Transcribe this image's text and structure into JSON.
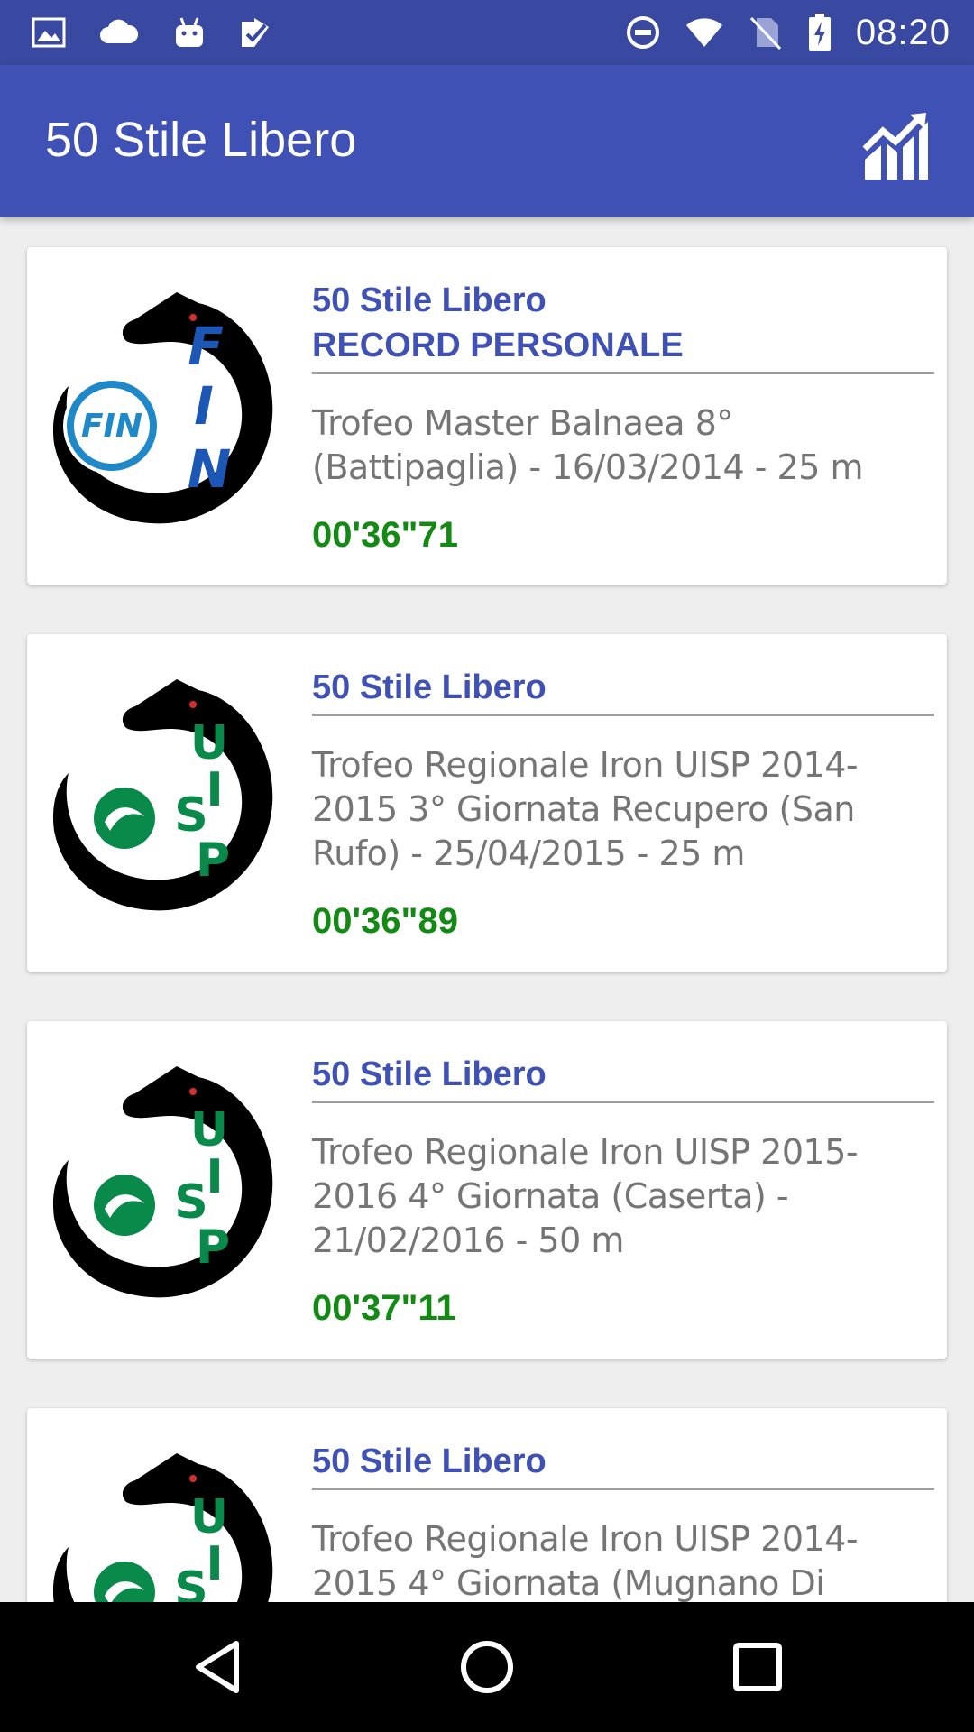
{
  "status_bar": {
    "time": "08:20",
    "left_icons": [
      "image-icon",
      "cloud-icon",
      "android-icon",
      "task-check-icon"
    ],
    "right_icons": [
      "do-not-disturb-icon",
      "wifi-icon",
      "no-sim-icon",
      "battery-charging-icon"
    ]
  },
  "app_bar": {
    "title": "50 Stile Libero",
    "action_icon": "chart-trend-icon"
  },
  "colors": {
    "status_bar": "#3949a1",
    "app_bar": "#3f51b5",
    "heading": "#3f51b5",
    "time": "#138a13",
    "description": "#757575"
  },
  "results": [
    {
      "logo": "FIN",
      "title": "50 Stile Libero",
      "subtitle": "RECORD PERSONALE",
      "description": "Trofeo Master Balnaea 8° (Battipaglia) - 16/03/2014 - 25 m",
      "time": "00'36\"71"
    },
    {
      "logo": "UISP",
      "title": "50 Stile Libero",
      "subtitle": "",
      "description": "Trofeo Regionale Iron UISP 2014-2015 3° Giornata Recupero (San Rufo) - 25/04/2015 - 25 m",
      "time": "00'36\"89"
    },
    {
      "logo": "UISP",
      "title": "50 Stile Libero",
      "subtitle": "",
      "description": "Trofeo Regionale Iron UISP 2015-2016 4° Giornata (Caserta) - 21/02/2016 - 50 m",
      "time": "00'37\"11"
    },
    {
      "logo": "UISP",
      "title": "50 Stile Libero",
      "subtitle": "",
      "description": "Trofeo Regionale Iron UISP 2014-2015 4° Giornata (Mugnano Di",
      "time": ""
    }
  ],
  "nav_bar": {
    "buttons": [
      "back-icon",
      "home-icon",
      "recents-icon"
    ]
  }
}
